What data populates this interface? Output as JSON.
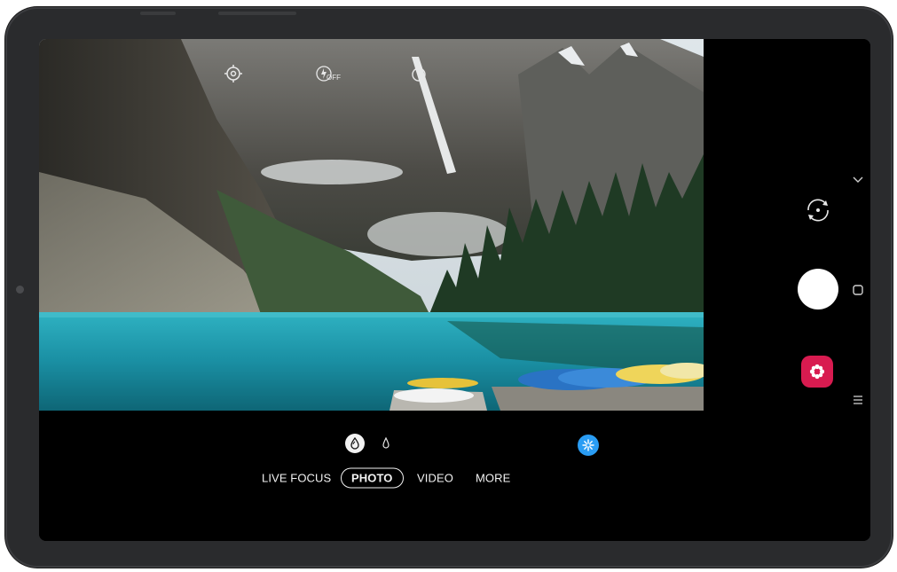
{
  "device": {
    "frame_color": "#2a2b2d",
    "screen_color": "#000000"
  },
  "viewfinder": {
    "scene": "mountain-lake-with-canoes",
    "top_icons": [
      {
        "name": "settings-icon"
      },
      {
        "name": "flash-off-icon",
        "label": "OFF"
      },
      {
        "name": "timer-icon"
      }
    ]
  },
  "lens_selector": {
    "options": [
      {
        "name": "wide-lens-icon",
        "selected": true
      },
      {
        "name": "normal-lens-icon",
        "selected": false
      }
    ]
  },
  "effect_button": {
    "icon": "filter-icon",
    "color": "#2a9df4"
  },
  "modes": {
    "items": [
      "LIVE FOCUS",
      "PHOTO",
      "VIDEO",
      "MORE"
    ],
    "selected": "PHOTO"
  },
  "right_panel": {
    "switch_camera": "switch-camera-icon",
    "shutter": "shutter-button",
    "gallery": {
      "icon": "gallery-icon",
      "color": "#d81b50"
    }
  },
  "system_nav": {
    "collapse": "chevron-down-icon",
    "home": "home-icon",
    "recents": "recents-icon"
  }
}
